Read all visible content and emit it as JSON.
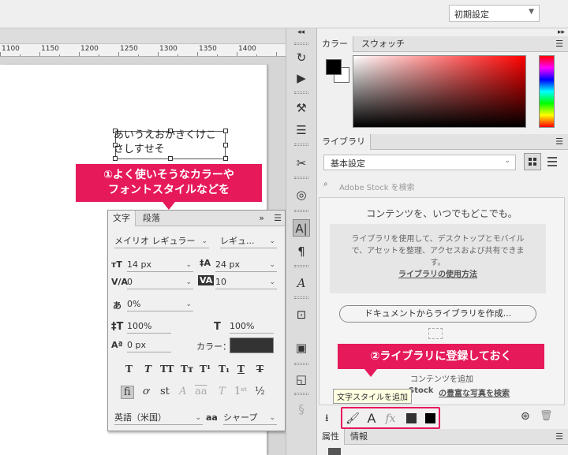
{
  "topbar": {
    "workspace": "初期設定"
  },
  "ruler": {
    "labels": [
      "1100",
      "1150",
      "1200",
      "1250",
      "1300",
      "1350",
      "1400"
    ]
  },
  "document": {
    "line1": "あいうえおかきくけこ",
    "line2": "さしすせそ"
  },
  "callouts": {
    "c1_line1": "①よく使いそうなカラーや",
    "c1_line2": "フォントスタイルなどを",
    "c2": "②ライブラリに登録しておく"
  },
  "char_panel": {
    "tab_character": "文字",
    "tab_paragraph": "段落",
    "font_family": "メイリオ レギュラー",
    "font_style": "レギュ...",
    "size": "14 px",
    "leading": "24 px",
    "kerning": "0",
    "tracking": "10",
    "tsume": "0%",
    "vscale": "100%",
    "hscale": "100%",
    "baseline": "0 px",
    "color_label": "カラー：",
    "language": "英語（米国）",
    "aa_label": "aa",
    "antialias": "シャープ"
  },
  "color_panel": {
    "tab_color": "カラー",
    "tab_swatches": "スウォッチ"
  },
  "library_panel": {
    "tab": "ライブラリ",
    "library": "基本設定",
    "search_placeholder": "Adobe Stock を検索",
    "heading": "コンテンツを、いつでもどこでも。",
    "info_line1": "ライブラリを使用して、デスクトップとモバイル",
    "info_line2": "で、アセットを整理、アクセスおよび共有できま",
    "info_line3": "す。",
    "info_link": "ライブラリの使用方法",
    "create_button": "ドキュメントからライブラリを作成...",
    "add_content": "コンテンツを追加",
    "stock_prefix": "Stock",
    "stock_link": "の豊富な写真を検索",
    "tooltip": "文字スタイルを追加"
  },
  "props_panel": {
    "tab_properties": "属性",
    "tab_info": "情報"
  }
}
